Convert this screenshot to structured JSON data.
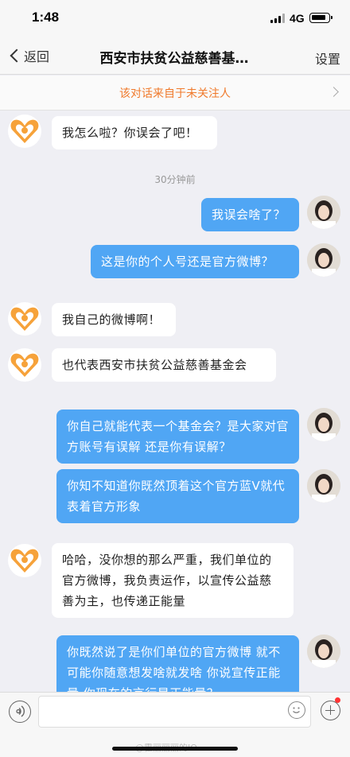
{
  "status_bar": {
    "time": "1:48",
    "network": "4G"
  },
  "nav": {
    "back_label": "返回",
    "title": "西安市扶贫公益慈善基…",
    "settings_label": "设置"
  },
  "notice": {
    "text": "该对话来自于未关注人"
  },
  "messages": [
    {
      "side": "left",
      "text": "我怎么啦？你误会了吧！"
    },
    {
      "type": "time",
      "text": "30分钟前"
    },
    {
      "side": "right",
      "text": "我误会啥了？"
    },
    {
      "side": "right",
      "text": "这是你的个人号还是官方微博？"
    },
    {
      "side": "left",
      "text": "我自己的微博啊！"
    },
    {
      "side": "left",
      "text": "也代表西安市扶贫公益慈善基金会"
    },
    {
      "side": "right",
      "text": "你自己就能代表一个基金会？是大家对官方账号有误解 还是你有误解？"
    },
    {
      "side": "right",
      "text": "你知不知道你既然顶着这个官方蓝V就代表着官方形象"
    },
    {
      "side": "left",
      "text": "哈哈，没你想的那么严重，我们单位的官方微博，我负责运作，以宣传公益慈善为主，也传递正能量"
    },
    {
      "side": "right",
      "text": "你既然说了是你们单位的官方微博 就不可能你随意想发啥就发啥 你说宣传正能量 你现在的言行是正能量？"
    }
  ],
  "watermark": "@霍丽丽丽的IO",
  "colors": {
    "accent_blue": "#50a6f4",
    "notice_orange": "#f07a2c",
    "chat_bg": "#efeff4"
  },
  "icons": [
    "back-chevron-icon",
    "signal-icon",
    "battery-icon",
    "voice-icon",
    "emoji-icon",
    "plus-icon",
    "chevron-right-icon"
  ]
}
